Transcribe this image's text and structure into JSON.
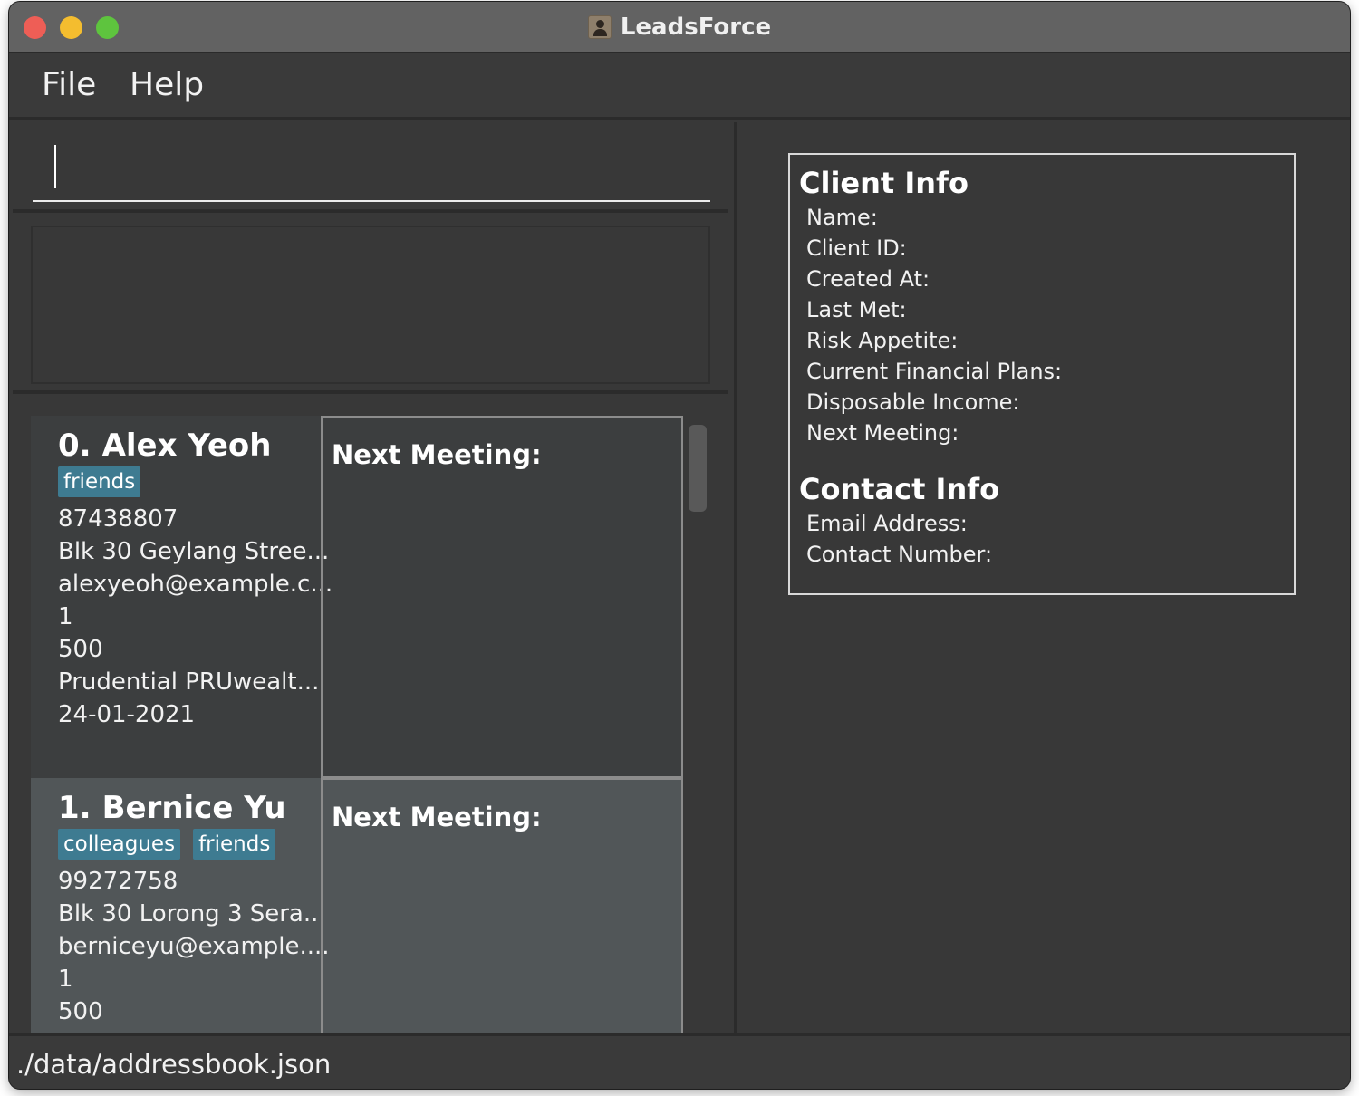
{
  "window": {
    "title": "LeadsForce"
  },
  "menu": {
    "file": "File",
    "help": "Help"
  },
  "command_box": {
    "value": ""
  },
  "result_display": {
    "text": ""
  },
  "person_list": [
    {
      "index": "0.",
      "name": "Alex Yeoh",
      "tags": [
        "friends"
      ],
      "phone": "87438807",
      "address": "Blk 30 Geylang Stree...",
      "email": "alexyeoh@example.c...",
      "risk_appetite": "1",
      "disposable_income": "500",
      "current_plan": "Prudential PRUwealt...",
      "last_met": "24-01-2021",
      "next_meeting_label": "Next Meeting:"
    },
    {
      "index": "1.",
      "name": "Bernice Yu",
      "tags": [
        "colleagues",
        "friends"
      ],
      "phone": "99272758",
      "address": "Blk 30 Lorong 3 Sera...",
      "email": "berniceyu@example....",
      "risk_appetite": "1",
      "disposable_income": "500",
      "next_meeting_label": "Next Meeting:"
    }
  ],
  "client_info": {
    "title": "Client Info",
    "fields": [
      "Name:",
      "Client ID:",
      "Created At:",
      "Last Met:",
      "Risk Appetite:",
      "Current Financial Plans:",
      "Disposable Income:",
      "Next Meeting:"
    ]
  },
  "contact_info": {
    "title": "Contact Info",
    "fields": [
      "Email Address:",
      "Contact Number:"
    ]
  },
  "status_bar": {
    "path": "./data/addressbook.json"
  },
  "colors": {
    "background": "#383838",
    "tag": "#3e7b91",
    "selected_card": "#515658",
    "titlebar": "#626262"
  }
}
